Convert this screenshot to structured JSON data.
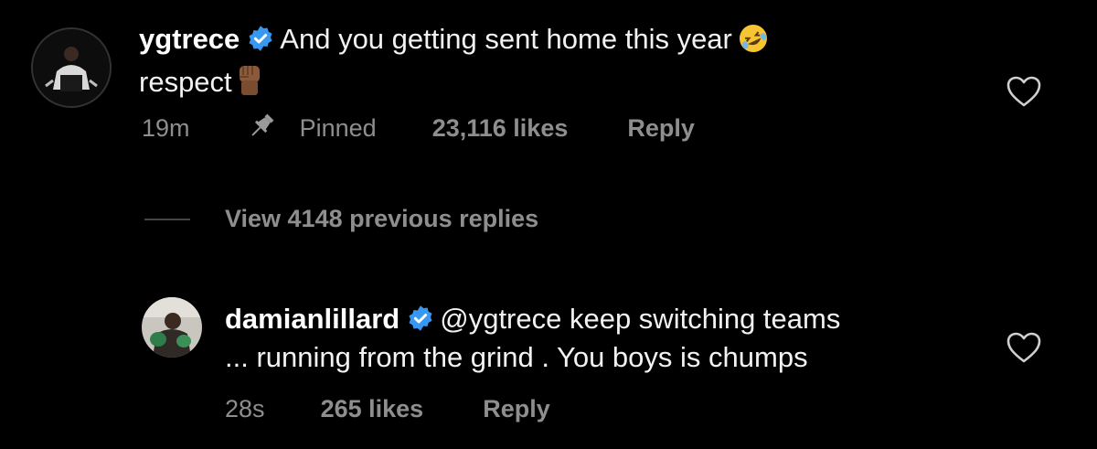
{
  "comments": [
    {
      "username": "ygtrece",
      "text_line1": "And you getting sent home this year",
      "text_line2": "respect",
      "emoji1": "rolling-on-floor-laughing-emoji",
      "emoji2": "raised-fist-emoji",
      "time": "19m",
      "pinned_label": "Pinned",
      "likes": "23,116 likes",
      "reply_label": "Reply"
    },
    {
      "username": "damianlillard",
      "text_line1": "@ygtrece keep switching teams",
      "text_line2": "... running from the grind . You boys is chumps",
      "time": "28s",
      "likes": "265 likes",
      "reply_label": "Reply"
    }
  ],
  "view_replies": "View 4148 previous replies",
  "colors": {
    "background": "#000000",
    "text": "#f2f2f2",
    "muted": "#8e8e8e",
    "verified": "#3897f0"
  }
}
